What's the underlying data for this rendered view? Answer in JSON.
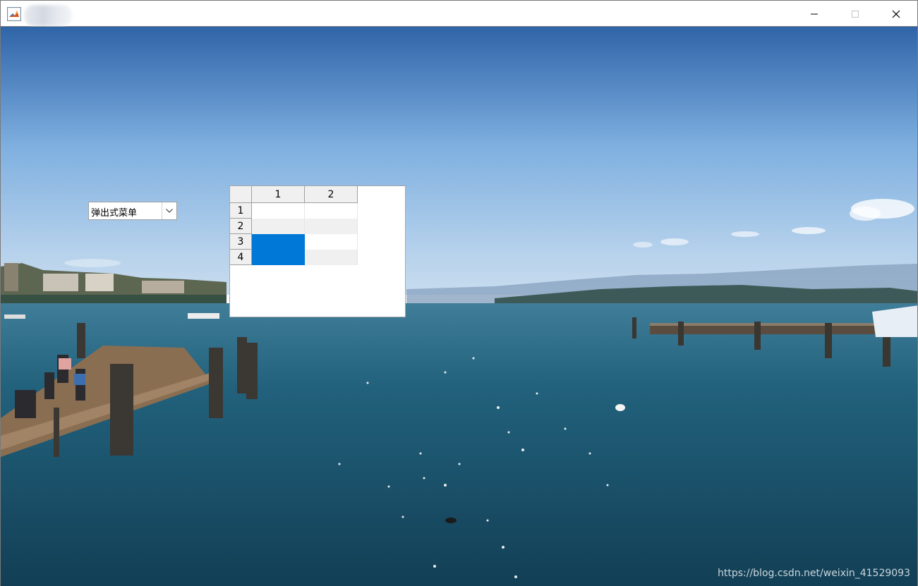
{
  "window": {
    "app_icon": "matlab-icon",
    "title": "",
    "controls": {
      "minimize": "minimize-icon",
      "maximize": "maximize-icon",
      "close": "close-icon"
    }
  },
  "popup_menu": {
    "selected": "弹出式菜单",
    "arrow_icon": "chevron-down-icon"
  },
  "table": {
    "column_headers": [
      "1",
      "2"
    ],
    "row_headers": [
      "1",
      "2",
      "3",
      "4"
    ],
    "selected_cells": [
      [
        3,
        1
      ],
      [
        4,
        1
      ]
    ],
    "selection_color": "#0078d7"
  },
  "watermark": "https://blog.csdn.net/weixin_41529093",
  "colors": {
    "sky_top": "#2f64a8",
    "sky_bottom": "#bcd3ea",
    "water": "#1b5670"
  }
}
